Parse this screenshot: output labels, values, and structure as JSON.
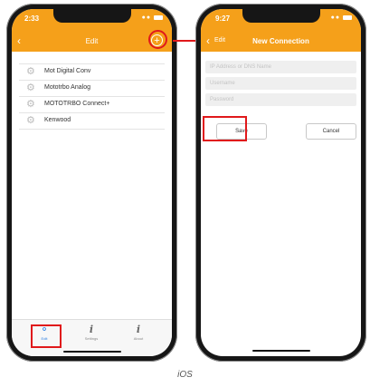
{
  "caption": "iOS",
  "left_screen": {
    "time": "2:33",
    "title": "Edit",
    "add_icon": "plus-circle-icon",
    "items": [
      {
        "label": "Mot Digital Conv"
      },
      {
        "label": "Mototrbo Analog"
      },
      {
        "label": "MOTOTRBO Connect+"
      },
      {
        "label": "Kenwood"
      }
    ],
    "tabs": [
      {
        "label": "Edit",
        "icon": "share-icon"
      },
      {
        "label": "Settings",
        "icon": "info-icon"
      },
      {
        "label": "About",
        "icon": "info-icon"
      }
    ]
  },
  "right_screen": {
    "time": "9:27",
    "back_label": "Edit",
    "title": "New Connection",
    "fields": {
      "address_placeholder": "IP Address or DNS Name",
      "username_placeholder": "Username",
      "password_placeholder": "Password"
    },
    "save_label": "Save",
    "cancel_label": "Cancel"
  },
  "colors": {
    "header": "#f5a01a",
    "highlight": "#e0191b",
    "active_tab": "#2a7de1"
  }
}
